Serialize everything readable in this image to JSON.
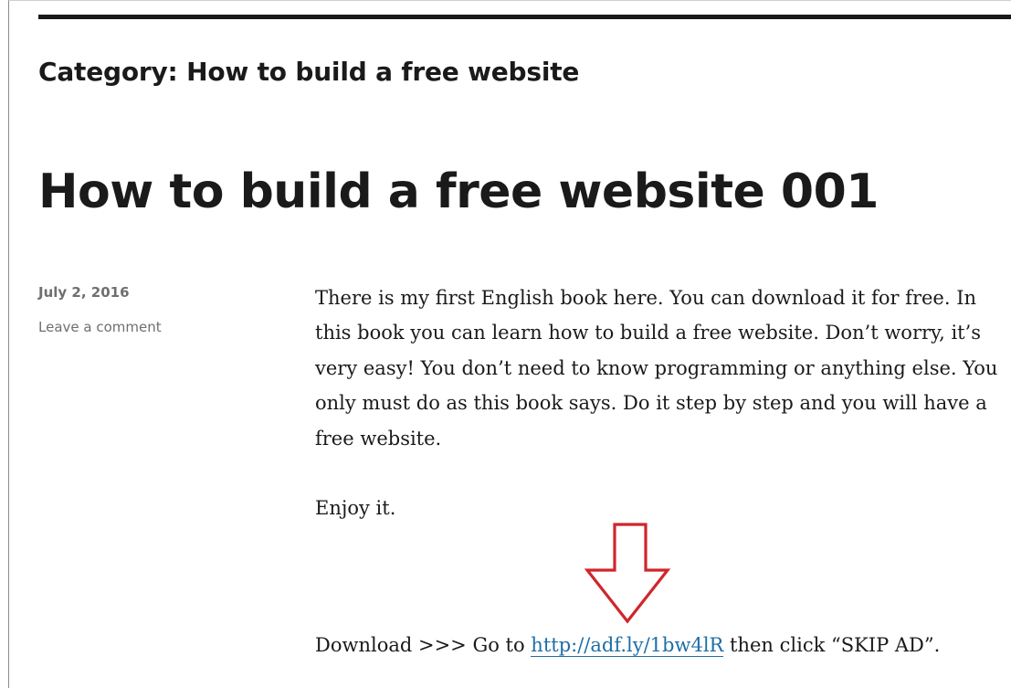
{
  "page": {
    "category_heading": "Category: How to build a free website",
    "post_title": "How to build a free website 001",
    "date": "July 2, 2016",
    "comment_link": "Leave a comment",
    "paragraphs": {
      "intro": "There is my first English book here. You can download it for free. In this book you can learn how to build a free website. Don’t worry, it’s very easy! You don’t need to know programming or anything else. You only must do as this book says. Do it step by step and you will have a free website.",
      "enjoy": "Enjoy it."
    },
    "download": {
      "prefix": "Download >>> Go to ",
      "link_text": "http://adf.ly/1bw4lR",
      "suffix": " then click “SKIP AD”."
    },
    "annotation": {
      "icon": "down-arrow-icon",
      "color": "#d0262b"
    },
    "colors": {
      "text": "#1a1a1a",
      "meta": "#6f6f6f",
      "link": "#1f6ea6"
    }
  }
}
